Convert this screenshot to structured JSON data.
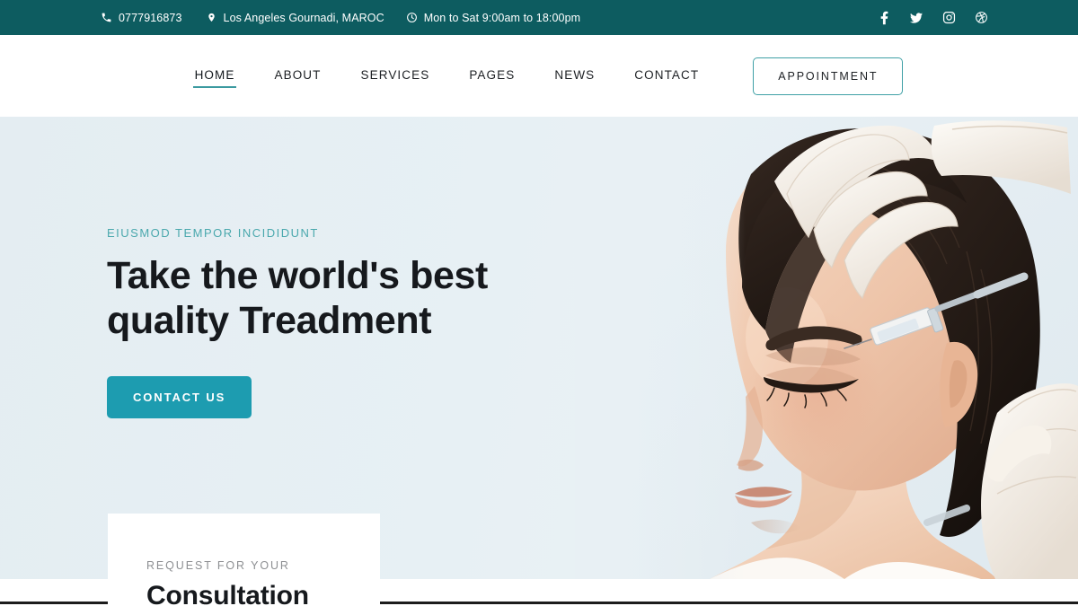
{
  "topbar": {
    "phone": "0777916873",
    "phone_icon": "phone-icon",
    "address": "Los Angeles Gournadi, MAROC",
    "address_icon": "map-pin-icon",
    "hours": "Mon to Sat 9:00am to 18:00pm",
    "hours_icon": "clock-icon",
    "background": "#0d5c60",
    "social": [
      {
        "name": "facebook-icon",
        "label": "Facebook"
      },
      {
        "name": "twitter-icon",
        "label": "Twitter"
      },
      {
        "name": "instagram-icon",
        "label": "Instagram"
      },
      {
        "name": "dribbble-icon",
        "label": "Dribbble"
      }
    ]
  },
  "nav": {
    "items": [
      {
        "label": "HOME",
        "active": true
      },
      {
        "label": "ABOUT",
        "active": false
      },
      {
        "label": "SERVICES",
        "active": false
      },
      {
        "label": "PAGES",
        "active": false
      },
      {
        "label": "NEWS",
        "active": false
      },
      {
        "label": "CONTACT",
        "active": false
      }
    ],
    "appointment_label": "APPOINTMENT",
    "active_underline_color": "#3b9aa0",
    "appointment_border_color": "#3fa0a6"
  },
  "hero": {
    "eyebrow": "EIUSMOD TEMPOR INCIDIDUNT",
    "eyebrow_color": "#4aa8ad",
    "title_line1": "Take the world's best",
    "title_line2": "quality Treadment",
    "cta_label": "CONTACT US",
    "cta_color": "#1d9cb0",
    "background_color": "#e7f0f4",
    "photo_alt": "woman receiving forehead injection treatment with gloved hands"
  },
  "consultation": {
    "subtitle": "REQUEST FOR YOUR",
    "title": "Consultation"
  }
}
